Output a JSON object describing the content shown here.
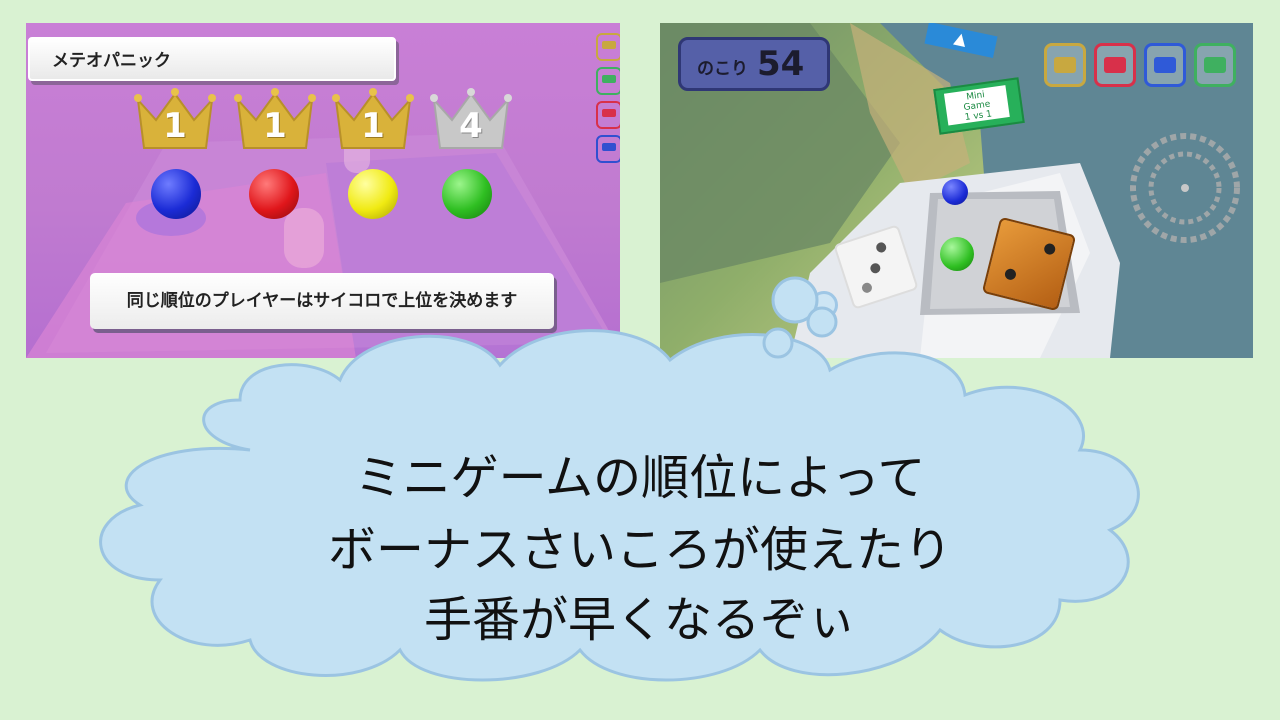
{
  "left_panel": {
    "title": "メテオパニック",
    "ranks": [
      "1",
      "1",
      "1",
      "4"
    ],
    "message": "同じ順位のプレイヤーはサイコロで上位を決めます",
    "colors": {
      "blue": "#1b2bd6",
      "red": "#e0161b",
      "yellow": "#f0ea12",
      "green": "#2fbf22"
    },
    "side_icons": [
      "robot-icon",
      "robot-icon",
      "robot-icon",
      "monkey-icon"
    ]
  },
  "right_panel": {
    "remaining_label": "のこり",
    "remaining_count": "54",
    "card": {
      "line1": "Mini",
      "line2": "Game",
      "line3": "1 vs 1"
    },
    "player_icons": [
      "robot-icon",
      "robot-icon",
      "robot-icon",
      "robot-icon"
    ]
  },
  "caption": {
    "line1": "ミニゲームの順位によって",
    "line2": "ボーナスさいころが使えたり",
    "line3": "手番が早くなるぞぃ"
  }
}
